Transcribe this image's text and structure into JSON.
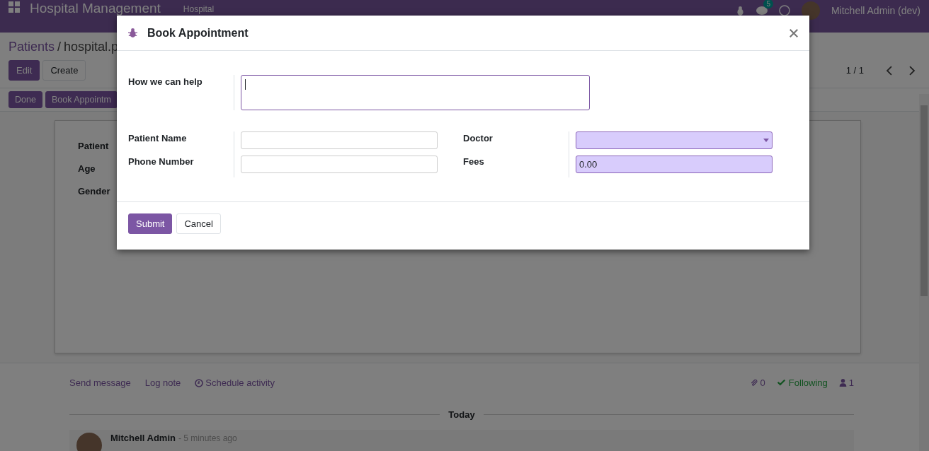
{
  "navbar": {
    "app_title": "Hospital Management",
    "menu": [
      "Hospital"
    ],
    "message_count": "5",
    "user": "Mitchell Admin (dev)"
  },
  "breadcrumb": {
    "parent": "Patients",
    "separator": "/",
    "current": "hospital.p"
  },
  "control_buttons": [
    {
      "label": "Edit",
      "primary": true
    },
    {
      "label": "Create",
      "primary": false
    }
  ],
  "pager": "1 / 1",
  "status_buttons": [
    {
      "label": "Done",
      "primary": true
    },
    {
      "label": "Book Appointm",
      "primary": true
    }
  ],
  "sheet": {
    "labels": [
      "Patient",
      "Age",
      "Gender"
    ]
  },
  "chatter": {
    "actions": [
      {
        "label": "Send message",
        "kind": "text"
      },
      {
        "label": "Log note",
        "kind": "text"
      },
      {
        "label": "Schedule activity",
        "kind": "clock"
      }
    ],
    "attachments": "0",
    "follow": {
      "label": "Following",
      "following": true
    },
    "followers": "1",
    "separator": "Today",
    "message": {
      "author": "Mitchell Admin",
      "time": "- 5 minutes ago"
    }
  },
  "dialog": {
    "title": "Book Appointment",
    "help": {
      "label": "How we can help",
      "focused": true,
      "required": false
    },
    "left_fields": [
      {
        "label": "Patient Name",
        "kind": "text",
        "required": false
      },
      {
        "label": "Phone Number",
        "kind": "text",
        "required": false
      }
    ],
    "right_fields": [
      {
        "label": "Doctor",
        "kind": "select",
        "required": true
      },
      {
        "label": "Fees",
        "kind": "text",
        "value": "0.00",
        "required": true
      }
    ],
    "buttons": [
      {
        "label": "Submit",
        "primary": true
      },
      {
        "label": "Cancel",
        "primary": false
      }
    ]
  }
}
